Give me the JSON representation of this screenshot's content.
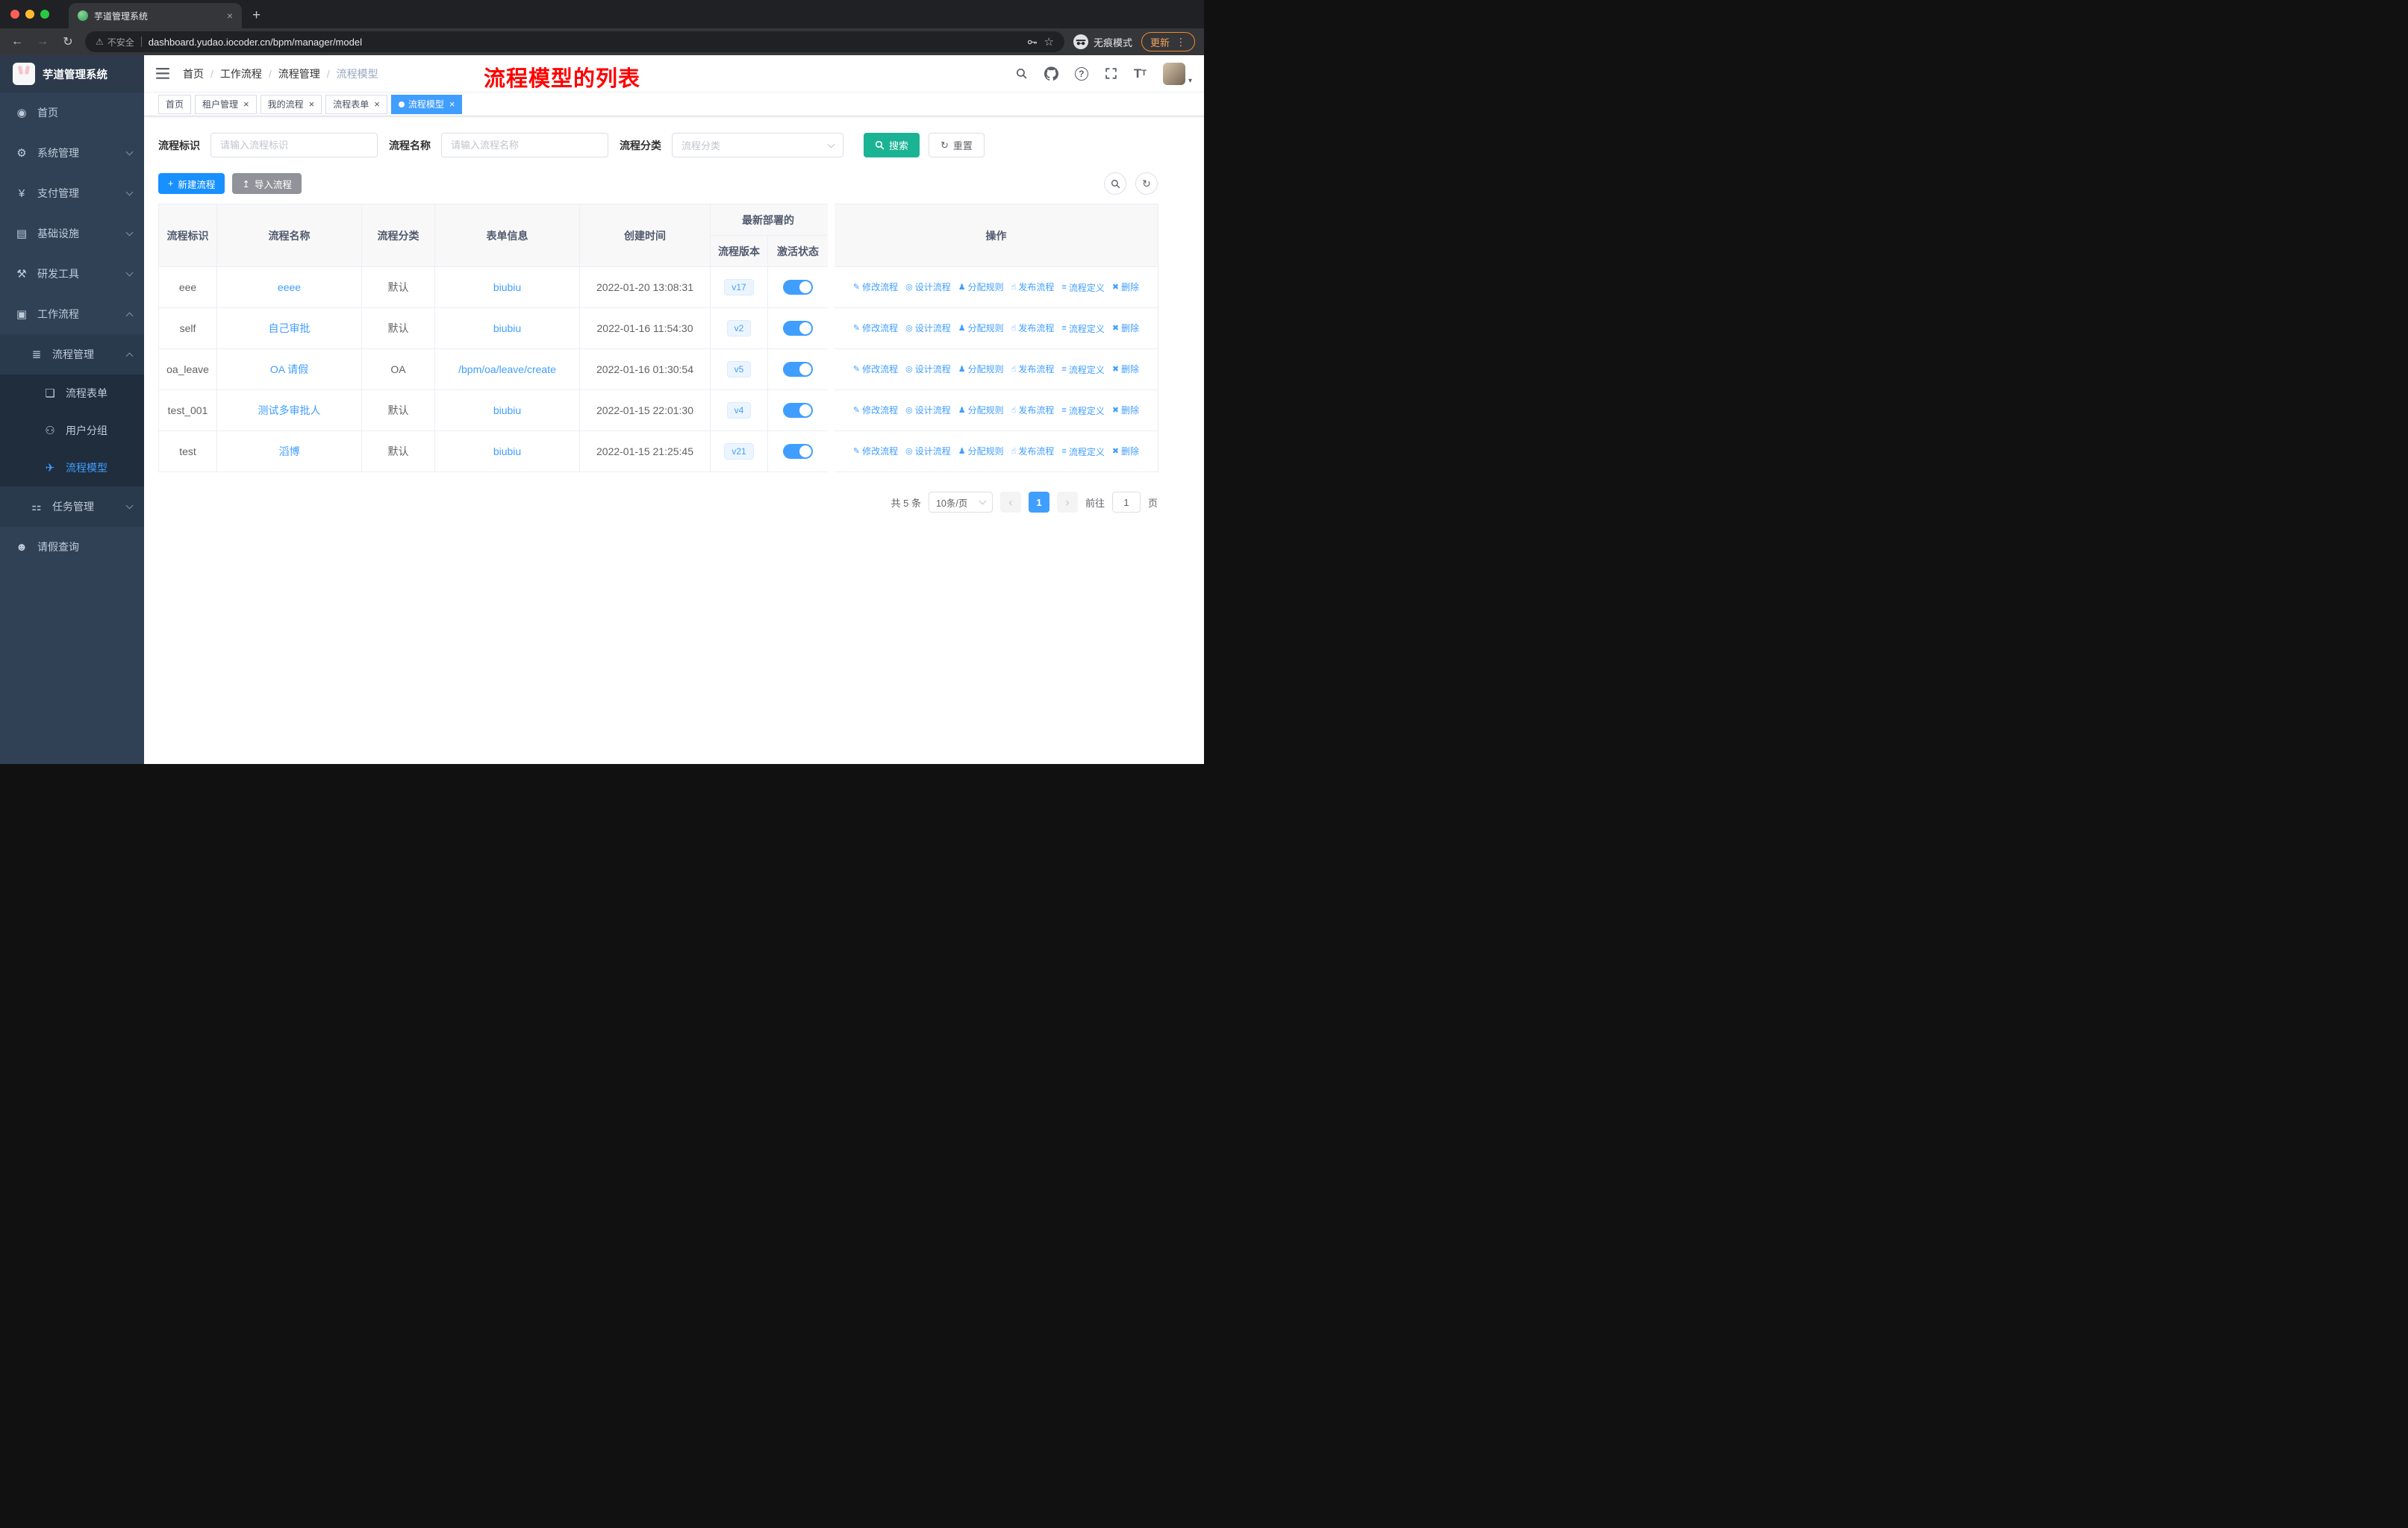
{
  "browser": {
    "tab_title": "芋道管理系统",
    "url": "dashboard.yudao.iocoder.cn/bpm/manager/model",
    "security_label": "不安全",
    "incognito_label": "无痕模式",
    "update_label": "更新"
  },
  "sidebar": {
    "logo_title": "芋道管理系统",
    "items": [
      {
        "key": "home",
        "label": "首页",
        "icon": "dashboard-icon",
        "depth": 0
      },
      {
        "key": "system",
        "label": "系统管理",
        "icon": "gear-icon",
        "depth": 0,
        "chevron": "down"
      },
      {
        "key": "payment",
        "label": "支付管理",
        "icon": "yen-icon",
        "depth": 0,
        "chevron": "down"
      },
      {
        "key": "infra",
        "label": "基础设施",
        "icon": "infra-icon",
        "depth": 0,
        "chevron": "down"
      },
      {
        "key": "devtools",
        "label": "研发工具",
        "icon": "devtools-icon",
        "depth": 0,
        "chevron": "down"
      },
      {
        "key": "workflow",
        "label": "工作流程",
        "icon": "workflow-icon",
        "depth": 0,
        "chevron": "up"
      },
      {
        "key": "process-manage",
        "label": "流程管理",
        "icon": "process-manage-icon",
        "depth": 1,
        "chevron": "up"
      },
      {
        "key": "process-form",
        "label": "流程表单",
        "icon": "form-icon",
        "depth": 2
      },
      {
        "key": "user-group",
        "label": "用户分组",
        "icon": "group-icon",
        "depth": 2
      },
      {
        "key": "process-model",
        "label": "流程模型",
        "icon": "model-icon",
        "depth": 2,
        "active": true
      },
      {
        "key": "task-manage",
        "label": "任务管理",
        "icon": "task-icon",
        "depth": 1,
        "chevron": "down"
      },
      {
        "key": "leave-query",
        "label": "请假查询",
        "icon": "user-icon",
        "depth": 0
      }
    ]
  },
  "header": {
    "breadcrumb": [
      "首页",
      "工作流程",
      "流程管理",
      "流程模型"
    ],
    "annotation": "流程模型的列表"
  },
  "tags": [
    {
      "key": "home",
      "label": "首页",
      "closable": false
    },
    {
      "key": "tenant",
      "label": "租户管理",
      "closable": true
    },
    {
      "key": "my-process",
      "label": "我的流程",
      "closable": true
    },
    {
      "key": "process-form",
      "label": "流程表单",
      "closable": true
    },
    {
      "key": "process-model",
      "label": "流程模型",
      "closable": true,
      "active": true
    }
  ],
  "filters": {
    "id_label": "流程标识",
    "id_placeholder": "请输入流程标识",
    "name_label": "流程名称",
    "name_placeholder": "请输入流程名称",
    "category_label": "流程分类",
    "category_placeholder": "流程分类",
    "search_label": "搜索",
    "reset_label": "重置"
  },
  "toolbar": {
    "create_label": "新建流程",
    "import_label": "导入流程"
  },
  "table": {
    "headers": [
      "流程标识",
      "流程名称",
      "流程分类",
      "表单信息",
      "创建时间",
      "流程版本",
      "激活状态",
      "操作"
    ],
    "group_header": "最新部署的",
    "rows": [
      {
        "id": "eee",
        "name": "eeee",
        "category": "默认",
        "form": "biubiu",
        "created": "2022-01-20 13:08:31",
        "version": "v17",
        "active": true
      },
      {
        "id": "self",
        "name": "自己审批",
        "category": "默认",
        "form": "biubiu",
        "created": "2022-01-16 11:54:30",
        "version": "v2",
        "active": true
      },
      {
        "id": "oa_leave",
        "name": "OA 请假",
        "category": "OA",
        "form": "/bpm/oa/leave/create",
        "created": "2022-01-16 01:30:54",
        "version": "v5",
        "active": true
      },
      {
        "id": "test_001",
        "name": "测试多审批人",
        "category": "默认",
        "form": "biubiu",
        "created": "2022-01-15 22:01:30",
        "version": "v4",
        "active": true
      },
      {
        "id": "test",
        "name": "滔博",
        "category": "默认",
        "form": "biubiu",
        "created": "2022-01-15 21:25:45",
        "version": "v21",
        "active": true
      }
    ],
    "actions": [
      {
        "key": "edit",
        "label": "修改流程",
        "icon": "edit-icon"
      },
      {
        "key": "design",
        "label": "设计流程",
        "icon": "design-icon"
      },
      {
        "key": "assign",
        "label": "分配规则",
        "icon": "assign-icon"
      },
      {
        "key": "publish",
        "label": "发布流程",
        "icon": "publish-icon"
      },
      {
        "key": "definition",
        "label": "流程定义",
        "icon": "definition-icon"
      },
      {
        "key": "delete",
        "label": "删除",
        "icon": "delete-icon"
      }
    ]
  },
  "pagination": {
    "total": "共 5 条",
    "page_size": "10条/页",
    "current_page": "1",
    "goto_label": "前往",
    "goto_value": "1",
    "page_label": "页"
  },
  "icons": {
    "dashboard-icon": "◉",
    "gear-icon": "⚙",
    "yen-icon": "¥",
    "infra-icon": "▤",
    "devtools-icon": "⚒",
    "workflow-icon": "▣",
    "process-manage-icon": "≣",
    "form-icon": "❏",
    "group-icon": "⚇",
    "model-icon": "✈",
    "task-icon": "⚏",
    "user-icon": "☻",
    "edit-icon": "✎",
    "design-icon": "◎",
    "assign-icon": "♟",
    "publish-icon": "☝",
    "definition-icon": "≡",
    "delete-icon": "✖"
  },
  "colors": {
    "primary_blue": "#409eff",
    "create_button_blue": "#1890ff",
    "search_button_teal": "#1ab394",
    "import_button_gray": "#909399",
    "sidebar_bg": "#304156",
    "sidebar_submenu_bg": "#1f2d3d",
    "sidebar_text": "#bfcbd9",
    "annotation_red": "#ff0000",
    "tag_active_bg": "#409eff",
    "version_badge_bg": "#ecf5ff",
    "toggle_on": "#409eff",
    "table_header_bg": "#f8f8f9",
    "chrome_dark": "#202124",
    "chrome_toolbar": "#35363a",
    "update_pill_orange": "#f28b24"
  }
}
